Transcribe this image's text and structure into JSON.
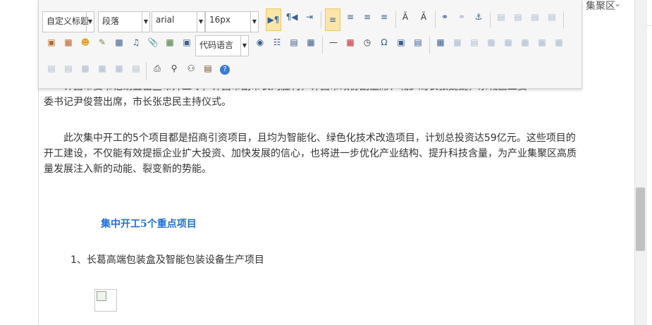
{
  "header": {
    "region": "集聚区"
  },
  "toolbar": {
    "custom_heading": "自定义标题",
    "paragraph": "段落",
    "font_family": "arial",
    "font_size": "16px",
    "code_language": "代码语言"
  },
  "content": {
    "p1_line1": "许昌市委书记胡五岳宣布开工令，许昌市副市长刘胜利，许昌市政协副主席、城乡局长张巍巍，东城区工委",
    "p1_line2": "委书记尹俊营出席，市长张忠民主持仪式。",
    "p2": "此次集中开工的5个项目都是招商引资项目，且均为智能化、绿色化技术改造项目，计划总投资达59亿元。这些项目的开工建设，不仅能有效提振企业扩大投资、加快发展的信心，也将进一步优化产业结构、提升科技含量，为产业集聚区高质量发展注入新的动能、裂变新的势能。",
    "heading": "集中开工5个重点项目",
    "item1": "1、长葛高端包装盒及智能包装设备生产项目"
  }
}
